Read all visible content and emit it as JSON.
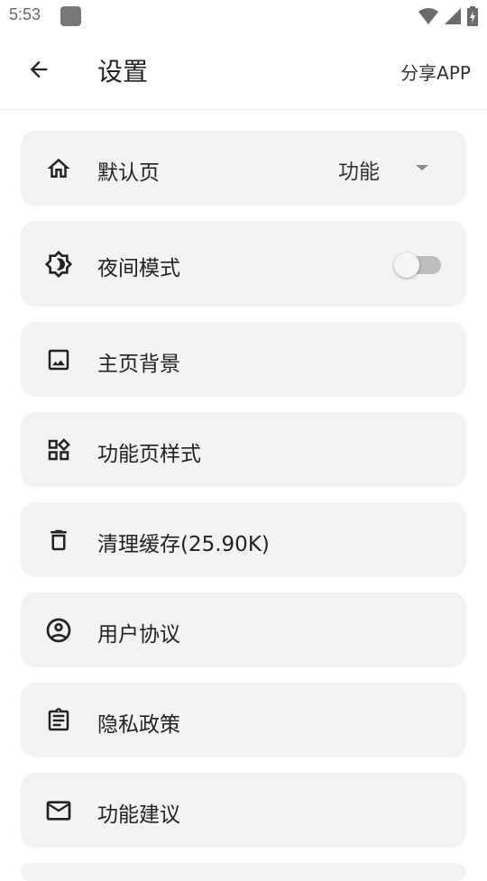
{
  "status_bar": {
    "time": "5:53"
  },
  "app_bar": {
    "title": "设置",
    "share_label": "分享APP"
  },
  "settings": [
    {
      "icon": "home-icon",
      "label": "默认页",
      "type": "dropdown",
      "value": "功能"
    },
    {
      "icon": "brightness-icon",
      "label": "夜间模式",
      "type": "toggle",
      "value": false
    },
    {
      "icon": "image-icon",
      "label": "主页背景",
      "type": "item"
    },
    {
      "icon": "widgets-icon",
      "label": "功能页样式",
      "type": "item"
    },
    {
      "icon": "trash-icon",
      "label": "清理缓存(25.90K)",
      "type": "item"
    },
    {
      "icon": "account-circle-icon",
      "label": "用户协议",
      "type": "item"
    },
    {
      "icon": "clipboard-icon",
      "label": "隐私政策",
      "type": "item"
    },
    {
      "icon": "mail-icon",
      "label": "功能建议",
      "type": "item"
    }
  ]
}
